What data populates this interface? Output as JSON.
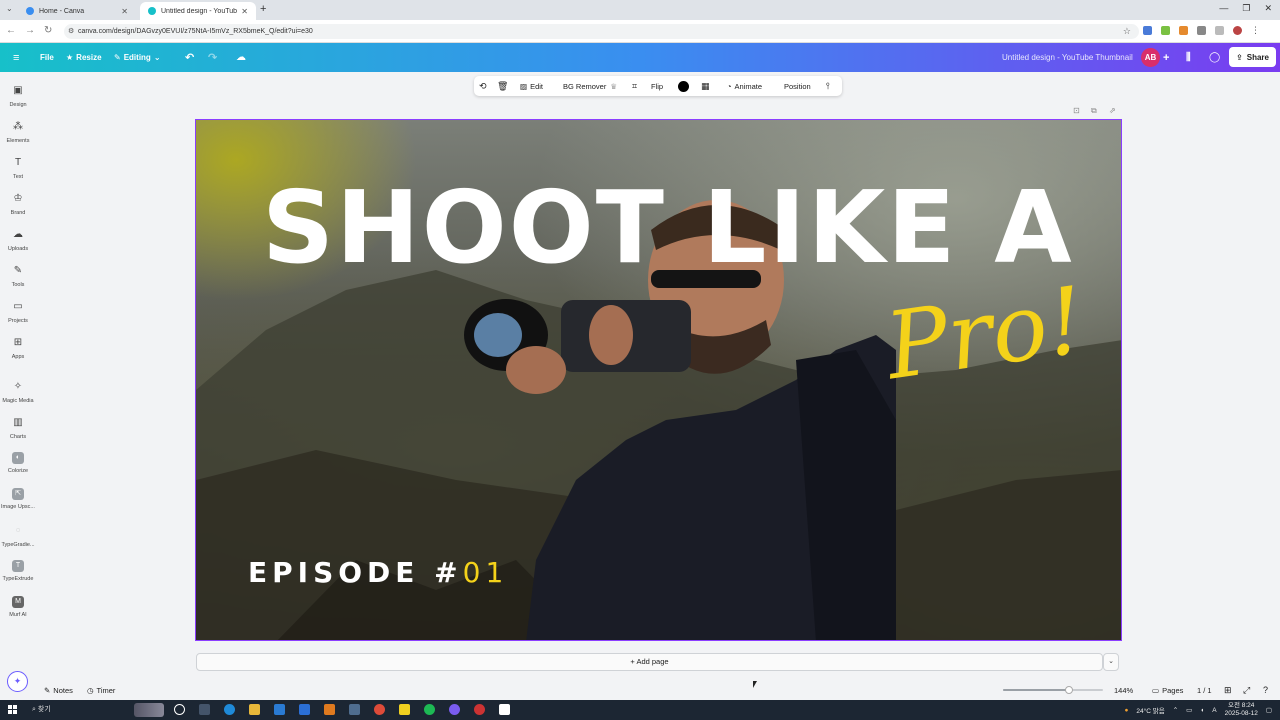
{
  "browser": {
    "tabs": [
      {
        "title": "Home - Canva",
        "active": false
      },
      {
        "title": "Untitled design - YouTube Th...",
        "active": true
      }
    ],
    "url": "canva.com/design/DAGvzy0EVUI/z75NtA-I5mVz_RX5bmeK_Q/edit?ui=e30"
  },
  "canva_bar": {
    "file": "File",
    "resize": "Resize",
    "editing": "Editing",
    "design_title": "Untitled design - YouTube Thumbnail",
    "avatar": "AB",
    "share": "Share"
  },
  "sidebar": {
    "items": [
      {
        "label": "Design",
        "icon": "design-icon"
      },
      {
        "label": "Elements",
        "icon": "elements-icon"
      },
      {
        "label": "Text",
        "icon": "text-icon"
      },
      {
        "label": "Brand",
        "icon": "brand-icon"
      },
      {
        "label": "Uploads",
        "icon": "uploads-icon"
      },
      {
        "label": "Tools",
        "icon": "tools-icon"
      },
      {
        "label": "Projects",
        "icon": "projects-icon"
      },
      {
        "label": "Apps",
        "icon": "apps-icon"
      },
      {
        "label": "Magic Media",
        "icon": "magic-media-icon"
      },
      {
        "label": "Charts",
        "icon": "charts-icon"
      },
      {
        "label": "Colorize",
        "icon": "colorize-icon"
      },
      {
        "label": "Image Upsc...",
        "icon": "image-upscaler-icon"
      },
      {
        "label": "TypeGradie...",
        "icon": "typegradient-icon"
      },
      {
        "label": "TypeExtrude",
        "icon": "typeextrude-icon"
      },
      {
        "label": "Murf AI",
        "icon": "murf-ai-icon"
      }
    ]
  },
  "context_toolbar": {
    "edit": "Edit",
    "bg_remover": "BG Remover",
    "flip": "Flip",
    "animate": "Animate",
    "position": "Position"
  },
  "canvas": {
    "headline": "SHOOT LIKE A",
    "script_text": "Pro!",
    "episode_label": "EPISODE #",
    "episode_number": "01"
  },
  "add_page": "+ Add page",
  "bottom_bar": {
    "notes": "Notes",
    "timer": "Timer",
    "zoom": "144%",
    "zoom_fraction": 0.66,
    "pages_label": "Pages",
    "page_count": "1 / 1"
  },
  "taskbar": {
    "search": "찾기",
    "weather": "24°C 맑음",
    "time": "오전 8:24",
    "date": "2025-08-12"
  },
  "colors": {
    "accent": "#8b3dff",
    "headline": "#ffffff",
    "script": "#f4d21a",
    "avatar": "#d92e6b"
  }
}
